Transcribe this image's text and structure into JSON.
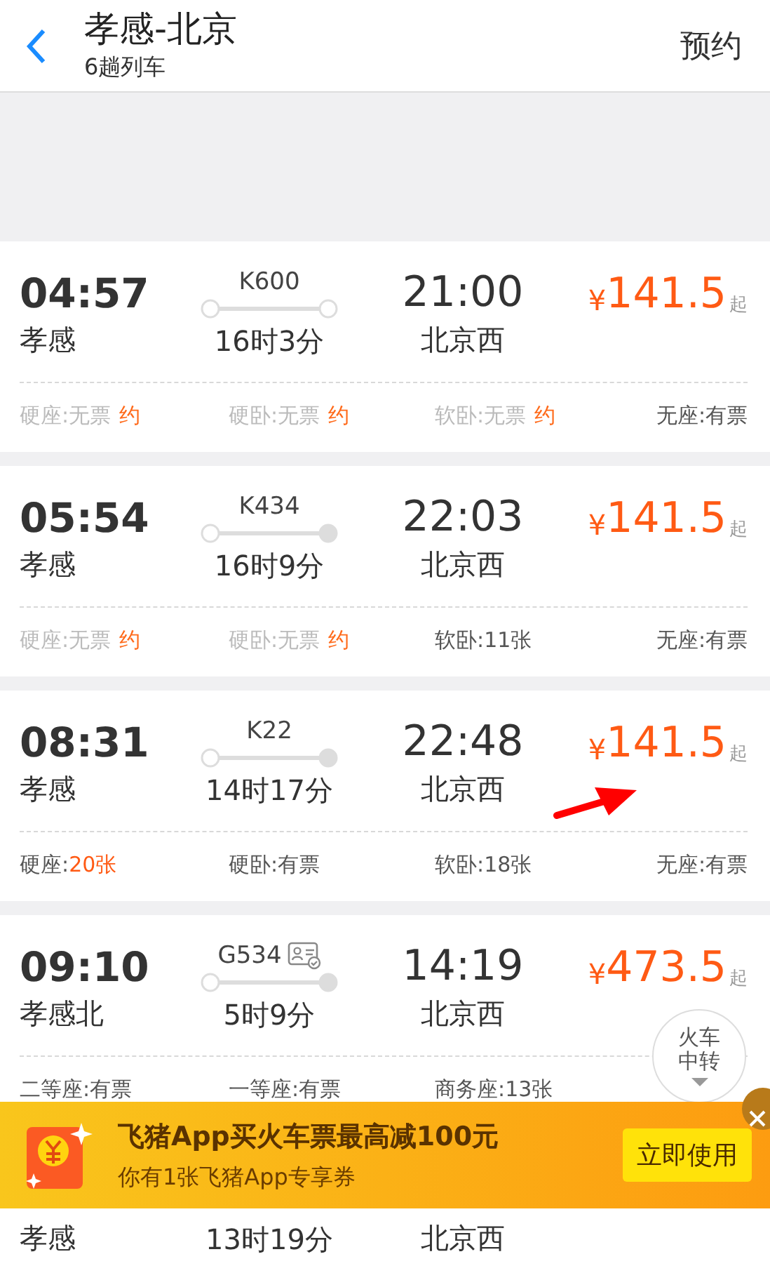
{
  "header": {
    "title": "孝感-北京",
    "subtitle": "6趟列车",
    "action": "预约"
  },
  "trains": [
    {
      "depart_time": "04:57",
      "depart_station": "孝感",
      "number": "K600",
      "id_check": false,
      "from_origin": true,
      "to_terminal": true,
      "duration": "16时3分",
      "arrive_time": "21:00",
      "arrive_station": "北京西",
      "currency": "¥",
      "price": "141.5",
      "price_suffix": "起",
      "seats": [
        {
          "label": "硬座:",
          "value": "无票",
          "available": false,
          "highlight": false,
          "reserve": "约"
        },
        {
          "label": "硬卧:",
          "value": "无票",
          "available": false,
          "highlight": false,
          "reserve": "约"
        },
        {
          "label": "软卧:",
          "value": "无票",
          "available": false,
          "highlight": false,
          "reserve": "约"
        },
        {
          "label": "无座:",
          "value": "有票",
          "available": true,
          "highlight": false
        }
      ]
    },
    {
      "depart_time": "05:54",
      "depart_station": "孝感",
      "number": "K434",
      "id_check": false,
      "from_origin": true,
      "to_terminal": false,
      "duration": "16时9分",
      "arrive_time": "22:03",
      "arrive_station": "北京西",
      "currency": "¥",
      "price": "141.5",
      "price_suffix": "起",
      "seats": [
        {
          "label": "硬座:",
          "value": "无票",
          "available": false,
          "highlight": false,
          "reserve": "约"
        },
        {
          "label": "硬卧:",
          "value": "无票",
          "available": false,
          "highlight": false,
          "reserve": "约"
        },
        {
          "label": "软卧:",
          "value": "11张",
          "available": true,
          "highlight": false
        },
        {
          "label": "无座:",
          "value": "有票",
          "available": true,
          "highlight": false
        }
      ]
    },
    {
      "depart_time": "08:31",
      "depart_station": "孝感",
      "number": "K22",
      "id_check": false,
      "from_origin": true,
      "to_terminal": false,
      "duration": "14时17分",
      "arrive_time": "22:48",
      "arrive_station": "北京西",
      "currency": "¥",
      "price": "141.5",
      "price_suffix": "起",
      "seats": [
        {
          "label": "硬座:",
          "value": "20张",
          "available": true,
          "highlight": true
        },
        {
          "label": "硬卧:",
          "value": "有票",
          "available": true,
          "highlight": false
        },
        {
          "label": "软卧:",
          "value": "18张",
          "available": true,
          "highlight": false
        },
        {
          "label": "无座:",
          "value": "有票",
          "available": true,
          "highlight": false
        }
      ]
    },
    {
      "depart_time": "09:10",
      "depart_station": "孝感北",
      "number": "G534",
      "id_check": true,
      "from_origin": true,
      "to_terminal": false,
      "duration": "5时9分",
      "arrive_time": "14:19",
      "arrive_station": "北京西",
      "currency": "¥",
      "price": "473.5",
      "price_suffix": "起",
      "seats": [
        {
          "label": "二等座:",
          "value": "有票",
          "available": true,
          "highlight": false
        },
        {
          "label": "一等座:",
          "value": "有票",
          "available": true,
          "highlight": false
        },
        {
          "label": "商务座:",
          "value": "13张",
          "available": true,
          "highlight": false
        }
      ]
    },
    {
      "depart_station": "孝感",
      "duration": "13时19分",
      "arrive_station": "北京西"
    }
  ],
  "transfer_button": "火车中转",
  "promo": {
    "title": "飞猪App买火车票最高减100元",
    "subtitle": "你有1张飞猪App专享券",
    "button": "立即使用"
  }
}
